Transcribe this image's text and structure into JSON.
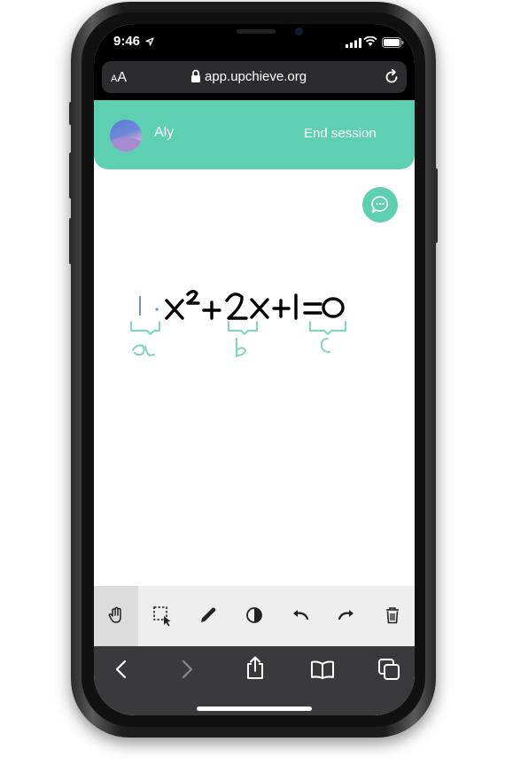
{
  "status_bar": {
    "time": "9:46",
    "icons": [
      "location-arrow-icon",
      "signal-bars-icon",
      "wifi-icon",
      "battery-icon"
    ]
  },
  "browser": {
    "text_size_label": "AA",
    "url": "app.upchieve.org",
    "icons": [
      "lock-icon",
      "reload-icon"
    ]
  },
  "session_header": {
    "tutor_name": "Aly",
    "end_session_label": "End session",
    "background_color": "#5dd0b1"
  },
  "chat_button": {
    "icon": "chat-bubble-icon"
  },
  "whiteboard": {
    "equation": "1·x²+2x+1=0",
    "annotations": [
      "a",
      "b",
      "c"
    ],
    "ink_color": "#000000",
    "annotation_color": "#7fd6bd",
    "cursor_color": "#6f8fd6"
  },
  "toolbar": {
    "tools": [
      {
        "name": "pan",
        "icon": "hand-icon",
        "active": true
      },
      {
        "name": "select",
        "icon": "select-box-icon",
        "active": false
      },
      {
        "name": "pen",
        "icon": "pencil-icon",
        "active": false
      },
      {
        "name": "color",
        "icon": "contrast-icon",
        "active": false
      },
      {
        "name": "undo",
        "icon": "undo-icon",
        "active": false
      },
      {
        "name": "redo",
        "icon": "redo-icon",
        "active": false
      },
      {
        "name": "clear",
        "icon": "trash-icon",
        "active": false
      }
    ]
  },
  "safari_toolbar": {
    "icons": [
      "back-icon",
      "forward-icon",
      "share-icon",
      "bookmarks-icon",
      "tabs-icon"
    ]
  }
}
